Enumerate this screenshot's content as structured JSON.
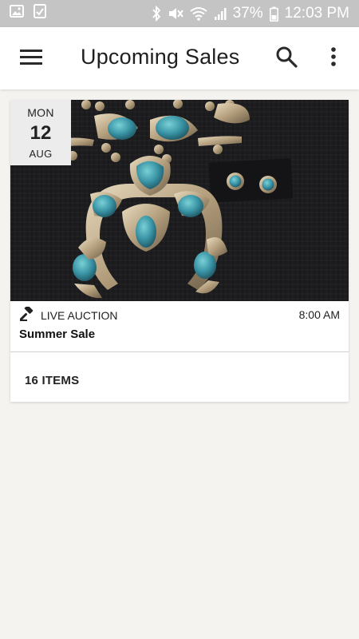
{
  "status_bar": {
    "battery": "37%",
    "time": "12:03 PM",
    "icons": [
      "image-icon",
      "check-box-icon",
      "bluetooth-icon",
      "mute-icon",
      "wifi-icon",
      "signal-icon",
      "battery-icon"
    ]
  },
  "app_bar": {
    "title": "Upcoming Sales",
    "menu_icon": "hamburger-menu-icon",
    "search_icon": "search-icon",
    "more_icon": "more-vert-icon"
  },
  "sales": [
    {
      "date": {
        "weekday": "MON",
        "day": "12",
        "month": "AUG"
      },
      "type": "LIVE AUCTION",
      "type_icon": "gavel-icon",
      "time": "8:00 AM",
      "title": "Summer Sale",
      "items": "16 ITEMS",
      "image_alt": "squash-blossom-necklace-photo"
    }
  ],
  "colors": {
    "status_bar_bg": "#c4c4c4",
    "app_bar_bg": "#ffffff",
    "page_bg": "#f4f3f0",
    "card_bg": "#ffffff",
    "date_badge_bg": "#ececec",
    "turquoise": "#3a8fa0",
    "silver": "#b9a98a"
  }
}
